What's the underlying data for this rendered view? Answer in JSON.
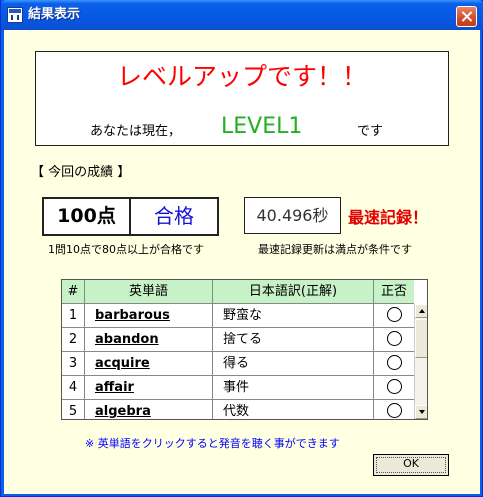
{
  "window": {
    "title": "結果表示"
  },
  "banner": {
    "headline": "レベルアップです！！",
    "prefix": "あなたは現在，",
    "level": "LEVEL1",
    "suffix": "です"
  },
  "results": {
    "section_label": "【 今回の成績 】",
    "score": "100点",
    "pass_label": "合格",
    "score_note": "1問10点で80点以上が合格です",
    "time": "40.496秒",
    "record_label": "最速記録！",
    "record_note": "最速記録更新は満点が条件です"
  },
  "table": {
    "headers": {
      "num": "#",
      "english": "英単語",
      "japanese": "日本語訳(正解)",
      "correct": "正否"
    },
    "rows": [
      {
        "num": "1",
        "english": "barbarous",
        "japanese": "野蛮な",
        "correct": "○"
      },
      {
        "num": "2",
        "english": "abandon",
        "japanese": "捨てる",
        "correct": "○"
      },
      {
        "num": "3",
        "english": "acquire",
        "japanese": "得る",
        "correct": "○"
      },
      {
        "num": "4",
        "english": "affair",
        "japanese": "事件",
        "correct": "○"
      },
      {
        "num": "5",
        "english": "algebra",
        "japanese": "代数",
        "correct": "○"
      }
    ]
  },
  "hint": "※ 英単語をクリックすると発音を聴く事ができます",
  "ok_label": "OK",
  "colors": {
    "accent_red": "#ff0000",
    "level_green": "#22b022",
    "pass_blue": "#1414d0",
    "header_green": "#c7f2c7",
    "background": "#ffffe1"
  }
}
